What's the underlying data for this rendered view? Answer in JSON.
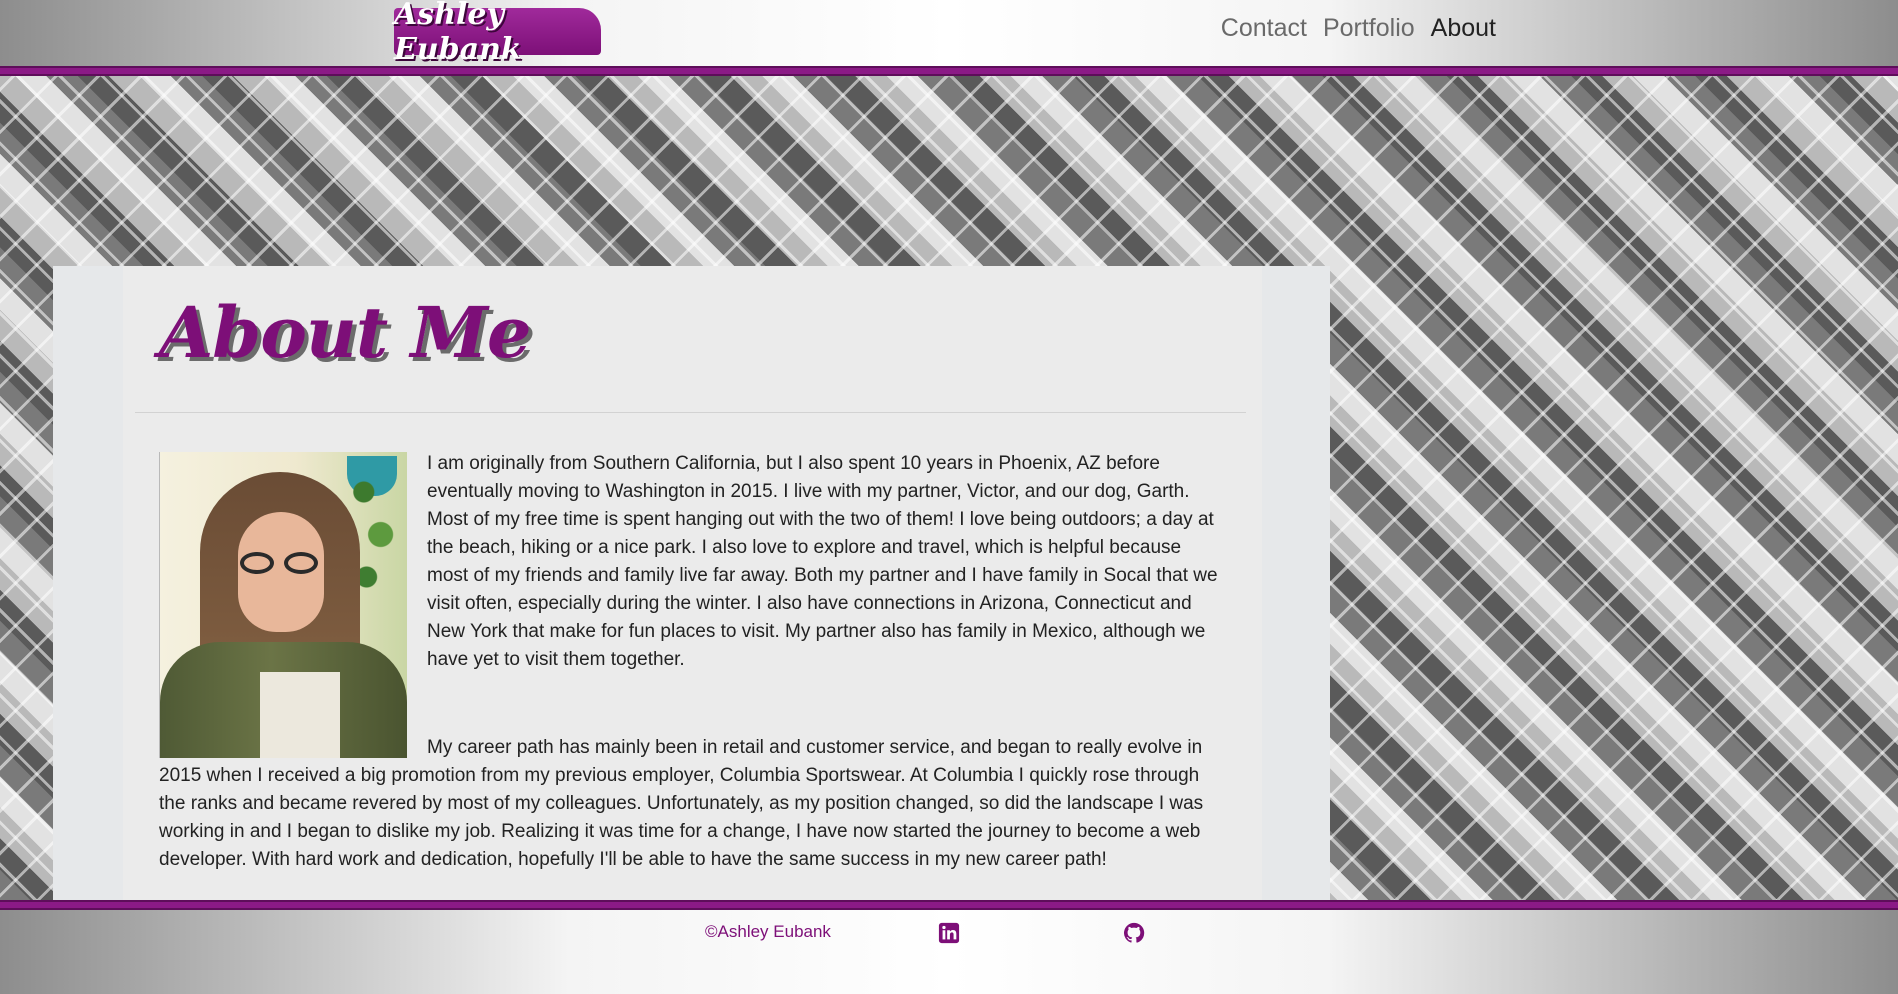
{
  "header": {
    "logo_text": "Ashley Eubank",
    "nav": [
      {
        "label": "Contact"
      },
      {
        "label": "Portfolio"
      },
      {
        "label": "About",
        "active": true
      }
    ]
  },
  "main": {
    "title": "About Me",
    "photo_alt": "Portrait of Ashley Eubank",
    "paragraphs": [
      "I am originally from Southern California, but I also spent 10 years in Phoenix, AZ before eventually moving to Washington in 2015. I live with my partner, Victor, and our dog, Garth. Most of my free time is spent hanging out with the two of them! I love being outdoors; a day at the beach, hiking or a nice park. I also love to explore and travel, which is helpful because most of my friends and family live far away. Both my partner and I have family in Socal that we visit often, especially during the winter. I also have connections in Arizona, Connecticut and New York that make for fun places to visit. My partner also has family in Mexico, although we have yet to visit them together.",
      "My career path has mainly been in retail and customer service, and began to really evolve in 2015 when I received a big promotion from my previous employer, Columbia Sportswear. At Columbia I quickly rose through the ranks and became revered by most of my colleagues. Unfortunately, as my position changed, so did the landscape I was working in and I began to dislike my job. Realizing it was time for a change, I have now started the journey to become a web developer. With hard work and dedication, hopefully I'll be able to have the same success in my new career path!"
    ]
  },
  "footer": {
    "copyright": "©Ashley Eubank",
    "icons": [
      "linkedin-icon",
      "github-icon"
    ]
  },
  "colors": {
    "brand_purple": "#7d0f78",
    "rule_purple": "#8b1a86"
  }
}
